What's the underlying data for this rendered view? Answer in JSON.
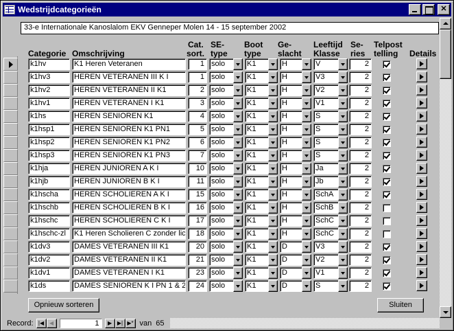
{
  "window": {
    "title": "Wedstrijdcategorieën"
  },
  "header_text": "33-e Internationale Kanoslalom EKV Genneper Molen  14 - 15  september 2002",
  "columns": {
    "categorie": "Categorie",
    "omschrijving": "Omschrijving",
    "cat_sort_1": "Cat.",
    "cat_sort_2": "sort.",
    "se_type_1": "SE-",
    "se_type_2": "type",
    "boot_type_1": "Boot",
    "boot_type_2": "type",
    "geslacht_1": "Ge-",
    "geslacht_2": "slacht",
    "leeftijd_1": "Leeftijd",
    "leeftijd_2": "Klasse",
    "series_1": "Se-",
    "series_2": "ries",
    "telpost_1": "Telpost",
    "telpost_2": "telling",
    "details": "Details"
  },
  "rows": [
    {
      "cat": "k1hv",
      "oms": "K1 Heren Veteranen",
      "sort": "1",
      "se": "solo",
      "boot": "K1",
      "gesl": "H",
      "klasse": "V",
      "series": "2",
      "telpost": true
    },
    {
      "cat": "k1hv3",
      "oms": "HEREN VETERANEN III  K I",
      "sort": "1",
      "se": "solo",
      "boot": "K1",
      "gesl": "H",
      "klasse": "V3",
      "series": "2",
      "telpost": true
    },
    {
      "cat": "k1hv2",
      "oms": "HEREN VETERANEN II  K1",
      "sort": "2",
      "se": "solo",
      "boot": "K1",
      "gesl": "H",
      "klasse": "V2",
      "series": "2",
      "telpost": true
    },
    {
      "cat": "k1hv1",
      "oms": "HEREN VETERANEN  I   K1",
      "sort": "3",
      "se": "solo",
      "boot": "K1",
      "gesl": "H",
      "klasse": "V1",
      "series": "2",
      "telpost": true
    },
    {
      "cat": "k1hs",
      "oms": "HEREN SENIOREN     K1",
      "sort": "4",
      "se": "solo",
      "boot": "K1",
      "gesl": "H",
      "klasse": "S",
      "series": "2",
      "telpost": true
    },
    {
      "cat": "k1hsp1",
      "oms": "HEREN SENIOREN     K1     PN1",
      "sort": "5",
      "se": "solo",
      "boot": "K1",
      "gesl": "H",
      "klasse": "S",
      "series": "2",
      "telpost": true
    },
    {
      "cat": "k1hsp2",
      "oms": "HEREN SENIOREN     K1     PN2",
      "sort": "6",
      "se": "solo",
      "boot": "K1",
      "gesl": "H",
      "klasse": "S",
      "series": "2",
      "telpost": true
    },
    {
      "cat": "k1hsp3",
      "oms": "HEREN SENIOREN     K1     PN3",
      "sort": "7",
      "se": "solo",
      "boot": "K1",
      "gesl": "H",
      "klasse": "S",
      "series": "2",
      "telpost": true
    },
    {
      "cat": "k1hja",
      "oms": "HEREN JUNIOREN A  K I",
      "sort": "10",
      "se": "solo",
      "boot": "K1",
      "gesl": "H",
      "klasse": "Ja",
      "series": "2",
      "telpost": true
    },
    {
      "cat": "k1hjb",
      "oms": "HEREN JUNIOREN B  K I",
      "sort": "11",
      "se": "solo",
      "boot": "K1",
      "gesl": "H",
      "klasse": "Jb",
      "series": "2",
      "telpost": true
    },
    {
      "cat": "k1hscha",
      "oms": "HEREN SCHOLIEREN A  K I",
      "sort": "15",
      "se": "solo",
      "boot": "K1",
      "gesl": "H",
      "klasse": "SchA",
      "series": "2",
      "telpost": true
    },
    {
      "cat": "k1hschb",
      "oms": "HEREN SCHOLIEREN B  K I",
      "sort": "16",
      "se": "solo",
      "boot": "K1",
      "gesl": "H",
      "klasse": "SchB",
      "series": "2",
      "telpost": false
    },
    {
      "cat": "k1hschc",
      "oms": "HEREN SCHOLIEREN C   K I",
      "sort": "17",
      "se": "solo",
      "boot": "K1",
      "gesl": "H",
      "klasse": "SchC",
      "series": "2",
      "telpost": false
    },
    {
      "cat": "k1hschc-zl",
      "oms": "K1 Heren Scholieren C zonder lice",
      "sort": "18",
      "se": "solo",
      "boot": "K1",
      "gesl": "H",
      "klasse": "SchC",
      "series": "2",
      "telpost": false
    },
    {
      "cat": "k1dv3",
      "oms": "DAMES VETERANEN III  K1",
      "sort": "20",
      "se": "solo",
      "boot": "K1",
      "gesl": "D",
      "klasse": "V3",
      "series": "2",
      "telpost": true
    },
    {
      "cat": "k1dv2",
      "oms": "DAMES VETERANEN II  K1",
      "sort": "21",
      "se": "solo",
      "boot": "K1",
      "gesl": "D",
      "klasse": "V2",
      "series": "2",
      "telpost": true
    },
    {
      "cat": "k1dv1",
      "oms": "DAMES VETERANEN I  K1",
      "sort": "23",
      "se": "solo",
      "boot": "K1",
      "gesl": "D",
      "klasse": "V1",
      "series": "2",
      "telpost": true
    },
    {
      "cat": "k1ds",
      "oms": "DAMES SENIOREN  K I   PN 1 & 2",
      "sort": "24",
      "se": "solo",
      "boot": "K1",
      "gesl": "D",
      "klasse": "S",
      "series": "2",
      "telpost": true
    }
  ],
  "buttons": {
    "resort": "Opnieuw sorteren",
    "close": "Sluiten"
  },
  "record_nav": {
    "label": "Record:",
    "current": "1",
    "of_label": "van",
    "total": "65"
  }
}
